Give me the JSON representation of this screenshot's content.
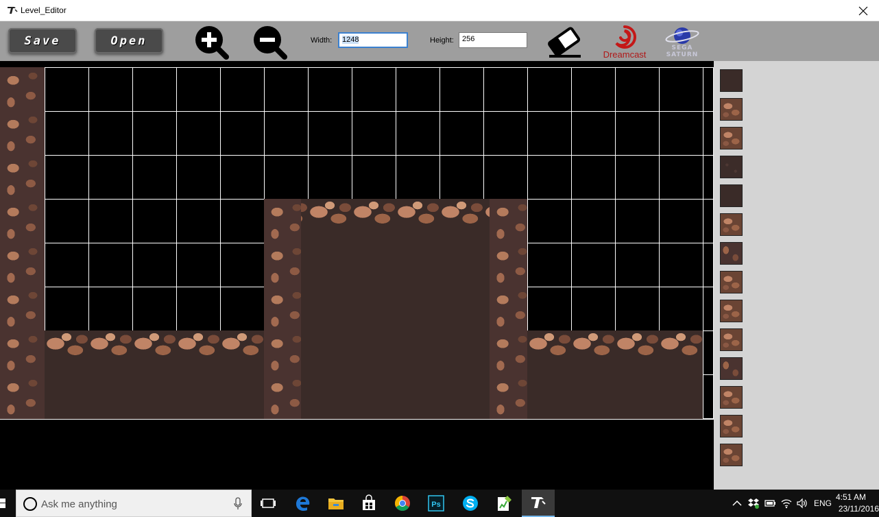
{
  "window": {
    "title": "Level_Editor",
    "icons": {
      "app": "tool-hammer-icon",
      "close": "close-icon"
    }
  },
  "toolbar": {
    "save_label": "Save",
    "open_label": "Open",
    "width_label": "Width:",
    "width_value": "1248",
    "height_label": "Height:",
    "height_value": "256",
    "dreamcast_label": "Dreamcast",
    "saturn_label": "SEGA SATURN",
    "icons": {
      "zoom_in": "zoom-in-icon",
      "zoom_out": "zoom-out-icon",
      "eraser": "eraser-icon",
      "dreamcast": "dreamcast-logo",
      "saturn": "sega-saturn-logo"
    }
  },
  "palette": {
    "tiles": [
      "dark",
      "rock",
      "rock",
      "dirt",
      "dark",
      "rock",
      "wall",
      "rock",
      "rock",
      "rock",
      "wall",
      "rock",
      "rock",
      "rock"
    ]
  },
  "colors": {
    "toolbar_bg": "#9e9e9e",
    "canvas_bg": "#000000",
    "grid_line": "#ffffff",
    "palette_bg": "#d4d4d4",
    "dirt": "#3a2b28",
    "rock": "#b47b5c",
    "dreamcast_red": "#b01818",
    "taskbar_bg": "#101010",
    "accent_blue": "#3a80d0"
  },
  "taskbar": {
    "search_placeholder": "Ask me anything",
    "language": "ENG",
    "time": "4:51 AM",
    "date": "23/11/2016",
    "apps": [
      "task-view-icon",
      "edge-icon",
      "file-explorer-icon",
      "store-icon",
      "chrome-icon",
      "photoshop-icon",
      "skype-icon",
      "notepad-plus-icon",
      "level-editor-icon"
    ],
    "tray": [
      "chevron-up-icon",
      "dropbox-icon",
      "battery-icon",
      "wifi-icon",
      "volume-icon"
    ],
    "photoshop_label": "Ps"
  }
}
